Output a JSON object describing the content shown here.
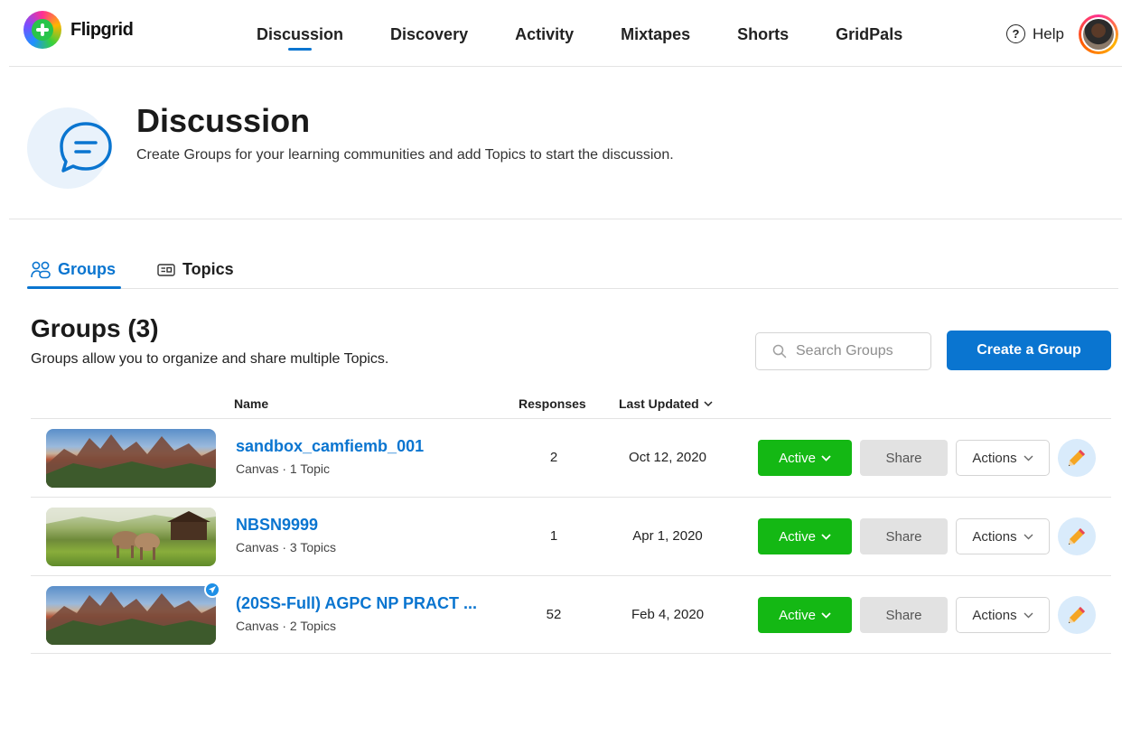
{
  "brand": {
    "name": "Flipgrid"
  },
  "nav": {
    "items": [
      {
        "label": "Discussion",
        "active": true
      },
      {
        "label": "Discovery"
      },
      {
        "label": "Activity"
      },
      {
        "label": "Mixtapes"
      },
      {
        "label": "Shorts"
      },
      {
        "label": "GridPals"
      }
    ],
    "help_label": "Help"
  },
  "hero": {
    "title": "Discussion",
    "subtitle": "Create Groups for your learning communities and add Topics to start the discussion."
  },
  "tabs": [
    {
      "label": "Groups",
      "active": true,
      "icon": "people-icon"
    },
    {
      "label": "Topics",
      "icon": "topic-card-icon"
    }
  ],
  "groups": {
    "title": "Groups (3)",
    "subtitle": "Groups allow you to organize and share multiple Topics.",
    "search_placeholder": "Search Groups",
    "create_label": "Create a Group",
    "columns": {
      "name": "Name",
      "responses": "Responses",
      "last_updated": "Last Updated"
    },
    "rows": [
      {
        "name": "sandbox_camfiemb_001",
        "meta": "Canvas · 1 Topic",
        "responses": "2",
        "updated": "Oct 12, 2020",
        "status": "Active",
        "share": "Share",
        "actions": "Actions",
        "thumb": "mountains"
      },
      {
        "name": "NBSN9999",
        "meta": "Canvas · 3 Topics",
        "responses": "1",
        "updated": "Apr 1, 2020",
        "status": "Active",
        "share": "Share",
        "actions": "Actions",
        "thumb": "cows"
      },
      {
        "name": "(20SS-Full) AGPC NP PRACT ...",
        "meta": "Canvas · 2 Topics",
        "responses": "52",
        "updated": "Feb 4, 2020",
        "status": "Active",
        "share": "Share",
        "actions": "Actions",
        "thumb": "mountains",
        "badge": "airplane-icon"
      }
    ]
  },
  "colors": {
    "accent": "#0a75d0",
    "active_green": "#14b814",
    "share_gray": "#e2e2e2"
  }
}
